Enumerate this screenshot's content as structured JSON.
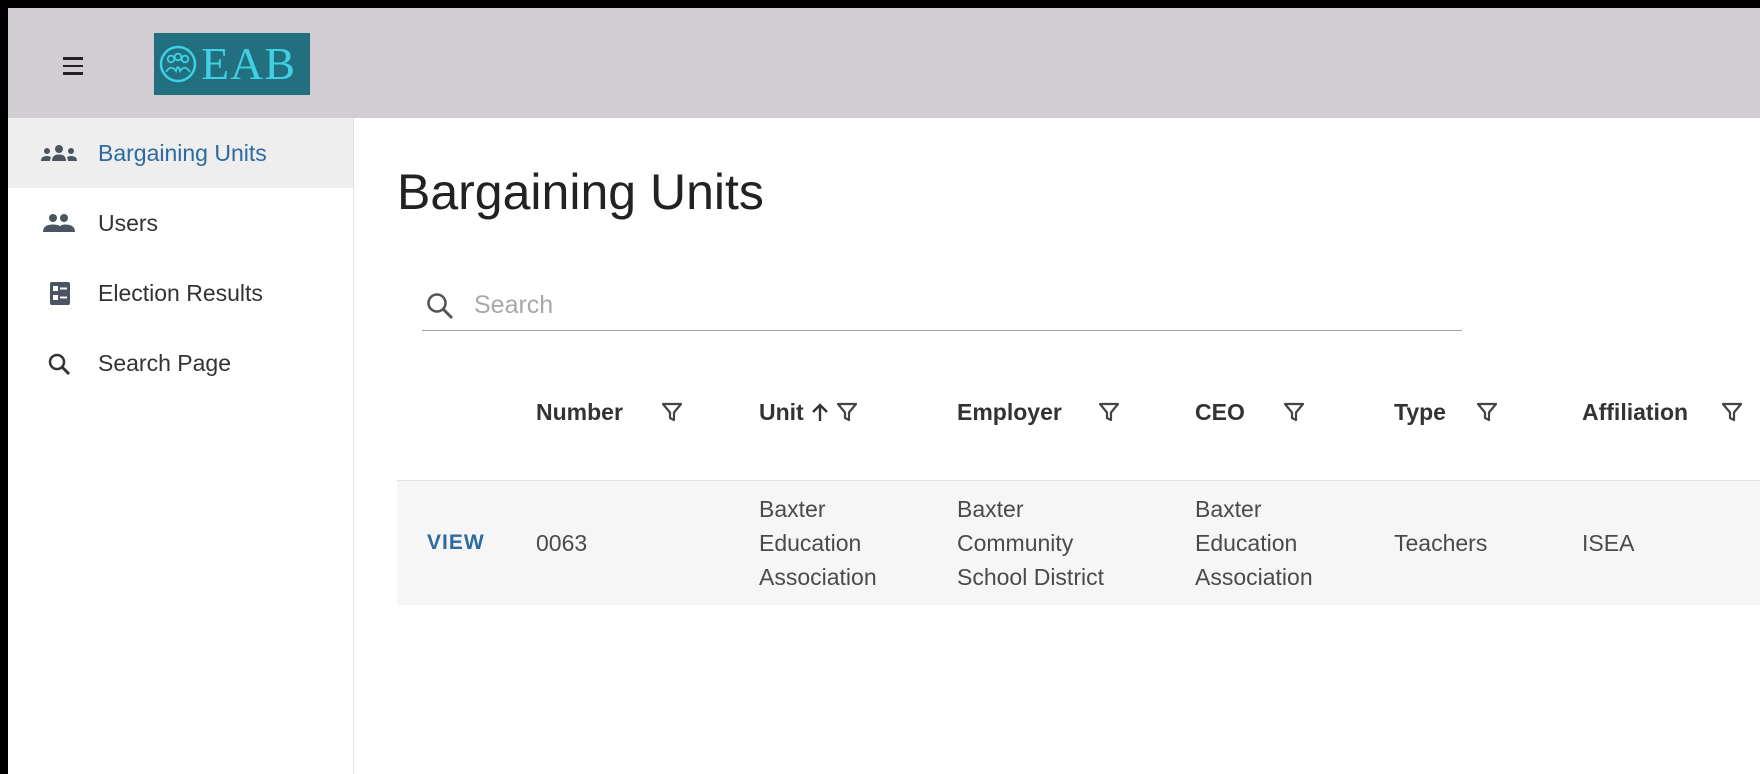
{
  "app": {
    "logo_text": "EAB"
  },
  "sidebar": {
    "items": [
      {
        "label": "Bargaining Units",
        "icon": "groups-icon",
        "active": true
      },
      {
        "label": "Users",
        "icon": "people-icon",
        "active": false
      },
      {
        "label": "Election Results",
        "icon": "list-box-icon",
        "active": false
      },
      {
        "label": "Search Page",
        "icon": "search-icon",
        "active": false
      }
    ]
  },
  "page": {
    "title": "Bargaining Units",
    "search_placeholder": "Search",
    "search_value": ""
  },
  "table": {
    "columns": [
      {
        "label": "Number",
        "sort_icon": ""
      },
      {
        "label": "Unit",
        "sort_icon": "arrow-up-icon"
      },
      {
        "label": "Employer",
        "sort_icon": ""
      },
      {
        "label": "CEO",
        "sort_icon": ""
      },
      {
        "label": "Type",
        "sort_icon": ""
      },
      {
        "label": "Affiliation",
        "sort_icon": ""
      }
    ],
    "rows": [
      {
        "action": "VIEW",
        "number": "0063",
        "unit": [
          "Baxter",
          "Education",
          "Association"
        ],
        "employer": [
          "Baxter",
          "Community",
          "School District"
        ],
        "ceo": [
          "Baxter",
          "Education",
          "Association"
        ],
        "type": "Teachers",
        "affiliation": "ISEA"
      }
    ]
  },
  "colors": {
    "topbar": "#d2cdd3",
    "accent": "#2d6a9f",
    "logo_bg": "#22707f",
    "logo_text": "#3fd0e2"
  }
}
